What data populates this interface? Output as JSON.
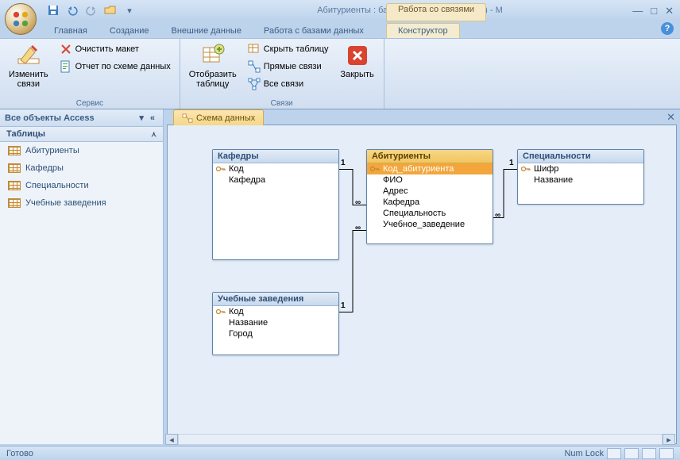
{
  "title": "Абитуриенты : база данных (Access 2007) - M",
  "contextTabGroup": "Работа со связями",
  "tabs": {
    "home": "Главная",
    "create": "Создание",
    "external": "Внешние данные",
    "db": "Работа с базами данных",
    "design": "Конструктор"
  },
  "ribbon": {
    "editRel": "Изменить\nсвязи",
    "clearLayout": "Очистить макет",
    "relReport": "Отчет по схеме данных",
    "groupTools": "Сервис",
    "showTable": "Отобразить\nтаблицу",
    "hideTable": "Скрыть таблицу",
    "directRel": "Прямые связи",
    "allRel": "Все связи",
    "groupRel": "Связи",
    "close": "Закрыть"
  },
  "nav": {
    "header": "Все объекты Access",
    "category": "Таблицы",
    "items": [
      "Абитуриенты",
      "Кафедры",
      "Специальности",
      "Учебные заведения"
    ]
  },
  "docTab": "Схема данных",
  "entities": {
    "kaf": {
      "title": "Кафедры",
      "fields": [
        "Код",
        "Кафедра"
      ],
      "keys": [
        0
      ]
    },
    "abit": {
      "title": "Абитуриенты",
      "fields": [
        "Код_абитуриента",
        "ФИО",
        "Адрес",
        "Кафедра",
        "Специальность",
        "Учебное_заведение"
      ],
      "keys": [
        0
      ],
      "selectedField": 0
    },
    "spec": {
      "title": "Специальности",
      "fields": [
        "Шифр",
        "Название"
      ],
      "keys": [
        0
      ]
    },
    "uch": {
      "title": "Учебные заведения",
      "fields": [
        "Код",
        "Название",
        "Город"
      ],
      "keys": [
        0
      ]
    }
  },
  "status": {
    "ready": "Готово",
    "numlock": "Num Lock"
  }
}
